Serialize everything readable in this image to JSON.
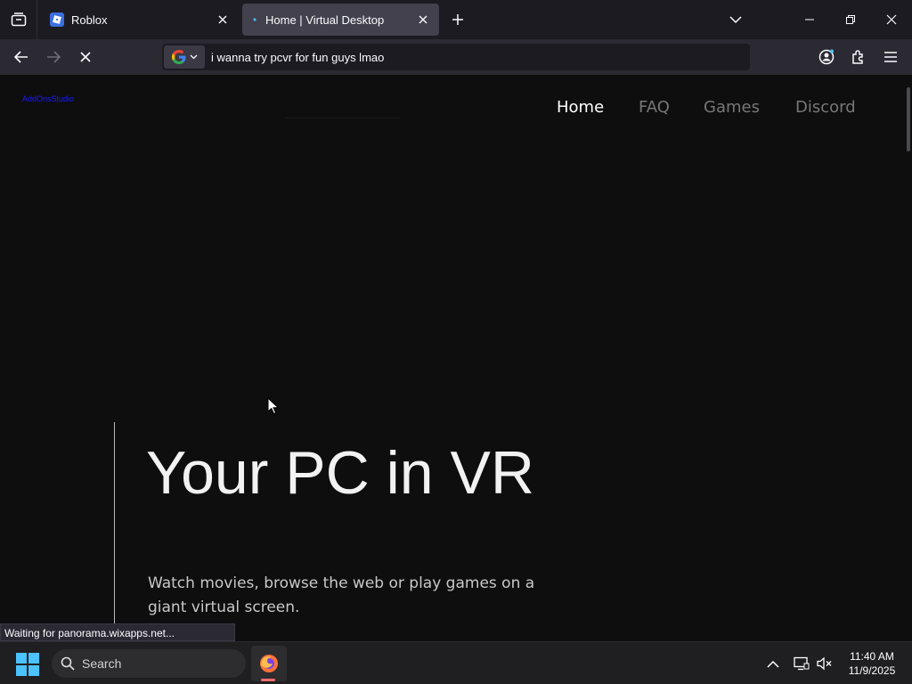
{
  "browser": {
    "tabs": [
      {
        "title": "Roblox",
        "active": false
      },
      {
        "title": "Home | Virtual Desktop",
        "active": true
      }
    ],
    "address_bar": {
      "value": "i wanna try pcvr for fun guys lmao",
      "search_engine": "google-icon"
    },
    "status_text": "Waiting for panorama.wixapps.net..."
  },
  "site": {
    "logo_text": "AddOnsStudio",
    "nav": {
      "home": "Home",
      "faq": "FAQ",
      "games": "Games",
      "discord": "Discord"
    },
    "hero": {
      "title": "Your PC in VR",
      "subtitle": "Watch movies, browse the web or play games on a giant virtual screen."
    }
  },
  "taskbar": {
    "search_label": "Search",
    "time": "11:40 AM",
    "date": "11/9/2025"
  },
  "colors": {
    "accent": "#4cc2ff",
    "page_bg": "#0e0e0f",
    "tab_active": "#42414d"
  }
}
